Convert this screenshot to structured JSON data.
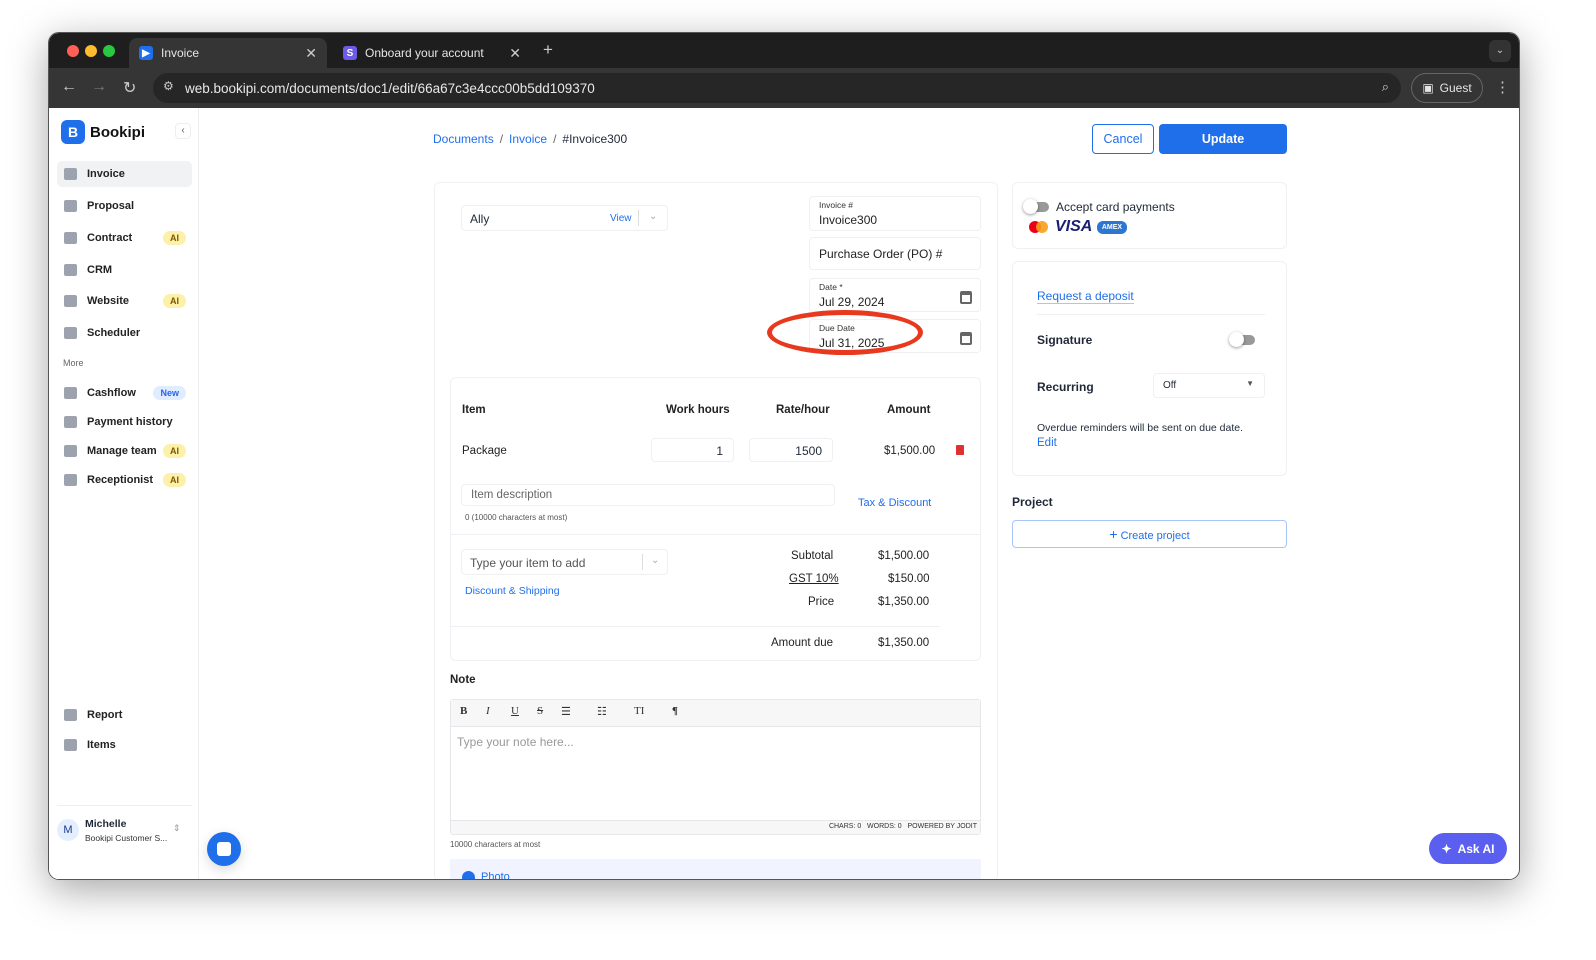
{
  "browser": {
    "tabs": [
      {
        "title": "Invoice",
        "active": true
      },
      {
        "title": "Onboard your account",
        "active": false
      }
    ],
    "url": "web.bookipi.com/documents/doc1/edit/66a67c3e4ccc00b5dd109370",
    "profile": "Guest"
  },
  "sidebar": {
    "brand": "Bookipi",
    "items": [
      {
        "label": "Invoice",
        "active": true
      },
      {
        "label": "Proposal"
      },
      {
        "label": "Contract",
        "badge": "AI"
      },
      {
        "label": "CRM"
      },
      {
        "label": "Website",
        "badge": "AI"
      },
      {
        "label": "Scheduler"
      }
    ],
    "more_label": "More",
    "more_items": [
      {
        "label": "Cashflow",
        "badge": "New"
      },
      {
        "label": "Payment history"
      },
      {
        "label": "Manage team",
        "badge": "AI"
      },
      {
        "label": "Receptionist",
        "badge": "AI"
      }
    ],
    "bottom_items": [
      {
        "label": "Report"
      },
      {
        "label": "Items"
      }
    ],
    "user": {
      "initial": "M",
      "name": "Michelle",
      "org": "Bookipi Customer S..."
    }
  },
  "breadcrumb": [
    "Documents",
    "Invoice",
    "#Invoice300"
  ],
  "actions": {
    "cancel": "Cancel",
    "update": "Update"
  },
  "client": {
    "name": "Ally",
    "view": "View"
  },
  "invoice_fields": {
    "invoice_no_label": "Invoice #",
    "invoice_no": "Invoice300",
    "po_placeholder": "Purchase Order (PO) #",
    "date_label": "Date *",
    "date": "Jul 29, 2024",
    "due_label": "Due Date",
    "due": "Jul 31, 2025"
  },
  "items_table": {
    "headers": [
      "Item",
      "Work hours",
      "Rate/hour",
      "Amount"
    ],
    "rows": [
      {
        "item": "Package",
        "hours": "1",
        "rate": "1500",
        "amount": "$1,500.00"
      }
    ],
    "desc_placeholder": "Item description",
    "desc_hint": "0 (10000 characters at most)",
    "tax_discount": "Tax & Discount",
    "add_placeholder": "Type your item to add",
    "discount_shipping": "Discount & Shipping"
  },
  "totals": {
    "subtotal_label": "Subtotal",
    "subtotal": "$1,500.00",
    "gst_label": "GST 10%",
    "gst": "$150.00",
    "price_label": "Price",
    "price": "$1,350.00",
    "due_label": "Amount due",
    "due": "$1,350.00"
  },
  "note": {
    "title": "Note",
    "toolbar": [
      "B",
      "I",
      "U",
      "S",
      "☰",
      "☷",
      "TI",
      "¶"
    ],
    "placeholder": "Type your note here...",
    "status": "CHARS: 0   WORDS: 0   POWERED BY JODIT",
    "hint": "10000 characters at most",
    "photo": "Photo"
  },
  "right": {
    "accept_card": "Accept card payments",
    "visa": "VISA",
    "amex": "AMEX",
    "request_deposit": "Request a deposit",
    "signature": "Signature",
    "recurring": "Recurring",
    "recurring_value": "Off",
    "reminder": "Overdue reminders will be sent on due date.",
    "edit": "Edit",
    "project_title": "Project",
    "create_project": "Create project"
  },
  "ask_ai": "Ask AI",
  "colors": {
    "accent": "#1f6feb",
    "annotation": "#e8391f"
  }
}
